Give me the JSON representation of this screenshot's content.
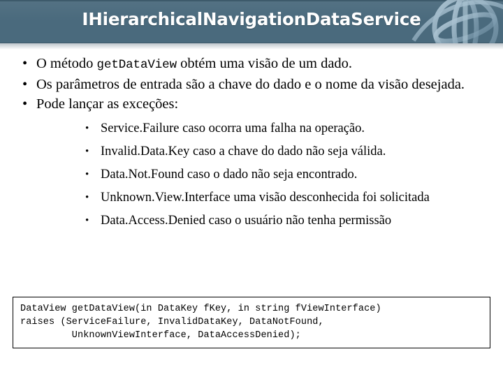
{
  "header": {
    "title": "IHierarchicalNavigationDataService",
    "background_color": "#4a6a7d",
    "title_color": "#ffffff",
    "decoration": "globe-wireframe"
  },
  "content": {
    "bullets": [
      {
        "bullet_glyph": "•",
        "parts": [
          {
            "type": "text",
            "value": "O método "
          },
          {
            "type": "code",
            "value": "getDataView"
          },
          {
            "type": "text",
            "value": " obtém uma visão de um dado."
          }
        ]
      },
      {
        "bullet_glyph": "•",
        "parts": [
          {
            "type": "text",
            "value": "Os parâmetros de entrada são a chave do dado e o nome da visão desejada."
          }
        ]
      },
      {
        "bullet_glyph": "•",
        "parts": [
          {
            "type": "text",
            "value": "Pode lançar as exceções:"
          }
        ]
      }
    ],
    "sub_bullets": [
      {
        "bullet_glyph": "•",
        "text": "Service.Failure caso ocorra uma falha na operação."
      },
      {
        "bullet_glyph": "•",
        "text": "Invalid.Data.Key caso a chave do dado não seja válida."
      },
      {
        "bullet_glyph": "•",
        "text": "Data.Not.Found caso o dado não seja encontrado."
      },
      {
        "bullet_glyph": "•",
        "text": "Unknown.View.Interface uma visão desconhecida foi solicitada"
      },
      {
        "bullet_glyph": "•",
        "text": "Data.Access.Denied caso o usuário não tenha permissão"
      }
    ],
    "code_block": "DataView getDataView(in DataKey fKey, in string fViewInterface)\nraises (ServiceFailure, InvalidDataKey, DataNotFound,\n         UnknownViewInterface, DataAccessDenied);"
  }
}
